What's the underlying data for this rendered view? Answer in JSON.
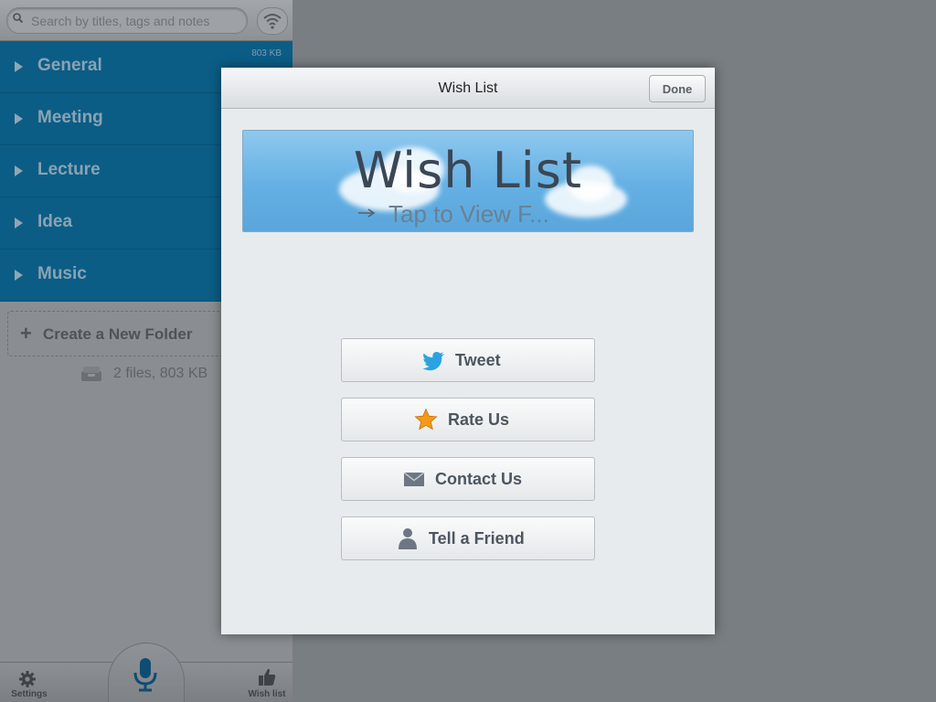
{
  "sidebar": {
    "search": {
      "placeholder": "Search by titles, tags and notes",
      "value": ""
    },
    "folders": [
      {
        "label": "General",
        "size": "803 KB"
      },
      {
        "label": "Meeting",
        "size": ""
      },
      {
        "label": "Lecture",
        "size": ""
      },
      {
        "label": "Idea",
        "size": ""
      },
      {
        "label": "Music",
        "size": ""
      }
    ],
    "create_folder_label": "Create a New Folder",
    "create_folder_plus": "+",
    "storage_info": "2 files, 803 KB",
    "bottom_bar": {
      "settings_label": "Settings",
      "wishlist_label": "Wish list"
    }
  },
  "modal": {
    "title": "Wish List",
    "done_label": "Done",
    "banner": {
      "title": "Wish List",
      "subtitle": "Tap to View F..."
    },
    "actions": [
      {
        "label": "Tweet",
        "icon": "twitter-bird-icon"
      },
      {
        "label": "Rate Us",
        "icon": "star-icon"
      },
      {
        "label": "Contact Us",
        "icon": "envelope-icon"
      },
      {
        "label": "Tell a Friend",
        "icon": "person-icon"
      }
    ]
  },
  "colors": {
    "folder_row": "#0b5d86",
    "banner_sky": "#64b0e4",
    "twitter_blue": "#2aa3e0",
    "star_orange": "#f49a16"
  }
}
